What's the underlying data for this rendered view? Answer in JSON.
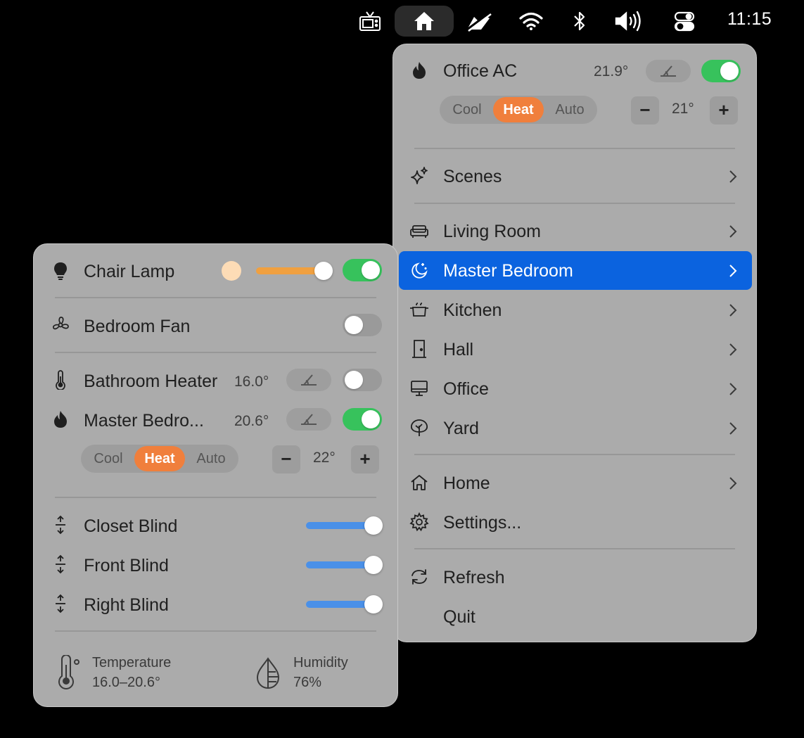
{
  "menubar": {
    "clock": "11:15",
    "icons": [
      "tv-icon",
      "home-icon",
      "airplay-icon",
      "wifi-icon",
      "bluetooth-icon",
      "volume-icon",
      "control-center-icon"
    ]
  },
  "main_menu": {
    "ac": {
      "name": "Office AC",
      "current_temp": "21.9°",
      "power_on": true,
      "modes": [
        "Cool",
        "Heat",
        "Auto"
      ],
      "active_mode": "Heat",
      "minus_label": "−",
      "plus_label": "+",
      "target_temp": "21°"
    },
    "scenes_label": "Scenes",
    "rooms": [
      {
        "label": "Living Room"
      },
      {
        "label": "Master Bedroom"
      },
      {
        "label": "Kitchen"
      },
      {
        "label": "Hall"
      },
      {
        "label": "Office"
      },
      {
        "label": "Yard"
      }
    ],
    "selected_room": "Master Bedroom",
    "home_label": "Home",
    "settings_label": "Settings...",
    "refresh_label": "Refresh",
    "quit_label": "Quit"
  },
  "sub_menu": {
    "lamp": {
      "name": "Chair Lamp",
      "color": "#fddcb6",
      "brightness": 1.0,
      "on": true
    },
    "fan": {
      "name": "Bedroom Fan",
      "on": false
    },
    "bathroom_heater": {
      "name": "Bathroom Heater",
      "current_temp": "16.0°",
      "on": false
    },
    "bedroom_heater": {
      "name": "Master Bedro...",
      "current_temp": "20.6°",
      "on": true,
      "modes": [
        "Cool",
        "Heat",
        "Auto"
      ],
      "active_mode": "Heat",
      "minus_label": "−",
      "plus_label": "+",
      "target_temp": "22°"
    },
    "blinds": [
      {
        "name": "Closet Blind",
        "position": 1.0
      },
      {
        "name": "Front Blind",
        "position": 1.0
      },
      {
        "name": "Right Blind",
        "position": 1.0
      }
    ],
    "sensors": {
      "temperature_label": "Temperature",
      "temperature_value": "16.0–20.6°",
      "humidity_label": "Humidity",
      "humidity_value": "76%"
    }
  },
  "colors": {
    "accent_selection": "#0b63df",
    "toggle_on": "#37c25c",
    "mode_active": "#f07f3c",
    "lamp_slider": "#f0a040",
    "blind_slider": "#4a90e8"
  }
}
